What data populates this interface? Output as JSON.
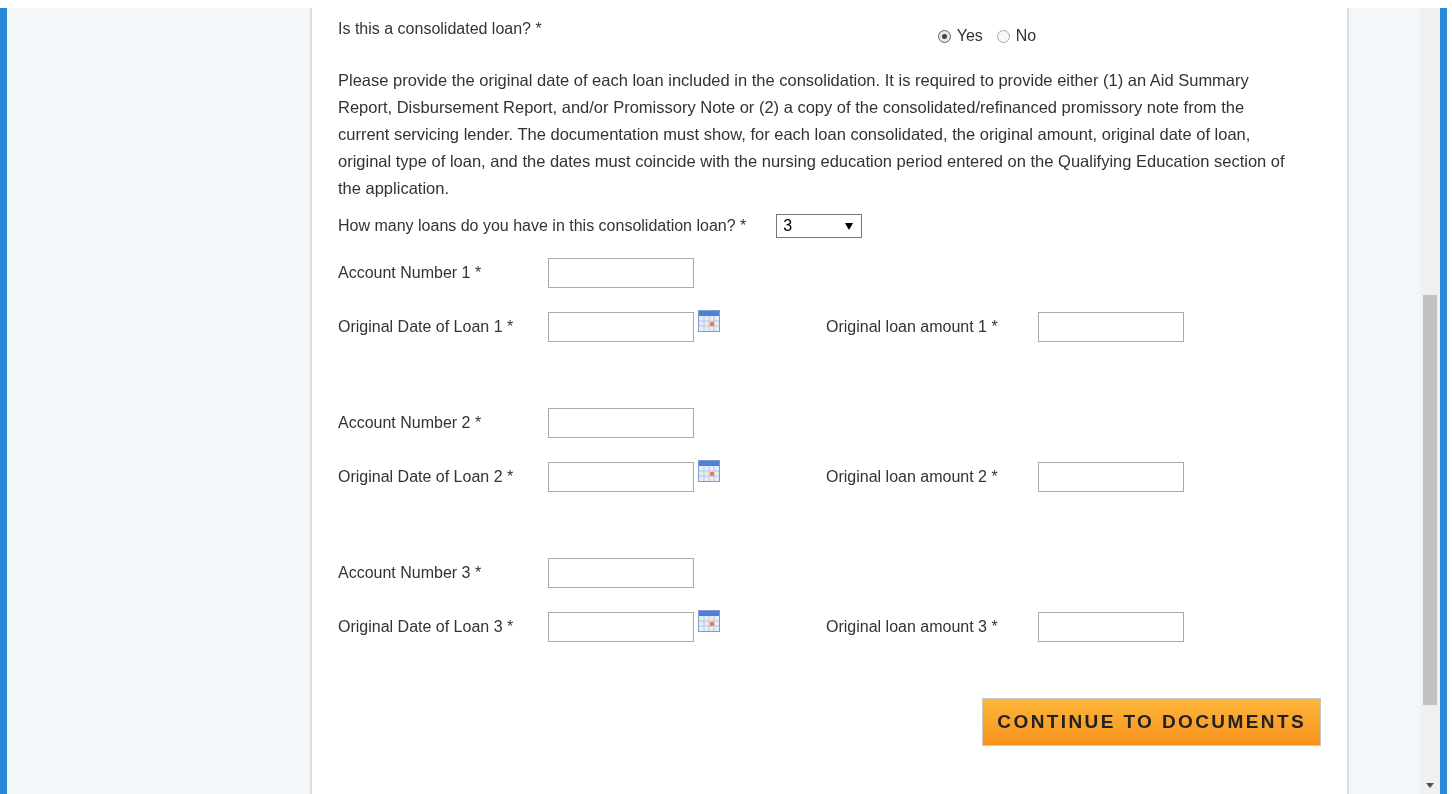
{
  "consolidated_question": {
    "label": "Is this a consolidated loan? *",
    "options": [
      {
        "label": "Yes",
        "selected": true
      },
      {
        "label": "No",
        "selected": false
      }
    ]
  },
  "instructions": "Please provide the original date of each loan included in the consolidation. It is required to provide either (1) an Aid Summary Report, Disbursement Report, and/or Promissory Note or (2) a copy of the consolidated/refinanced promissory note from the current servicing lender. The documentation must show, for each loan consolidated, the original amount, original date of loan, original type of loan, and the dates must coincide with the nursing education period entered on the Qualifying Education section of the application.",
  "loan_count": {
    "label": "How many loans do you have in this consolidation loan? *",
    "value": "3"
  },
  "loans": [
    {
      "account_label": "Account Number 1 *",
      "date_label": "Original Date of Loan 1 *",
      "amount_label": "Original loan amount 1 *"
    },
    {
      "account_label": "Account Number 2 *",
      "date_label": "Original Date of Loan 2 *",
      "amount_label": "Original loan amount 2 *"
    },
    {
      "account_label": "Account Number 3 *",
      "date_label": "Original Date of Loan 3 *",
      "amount_label": "Original loan amount 3 *"
    }
  ],
  "continue_button": "CONTINUE TO DOCUMENTS"
}
